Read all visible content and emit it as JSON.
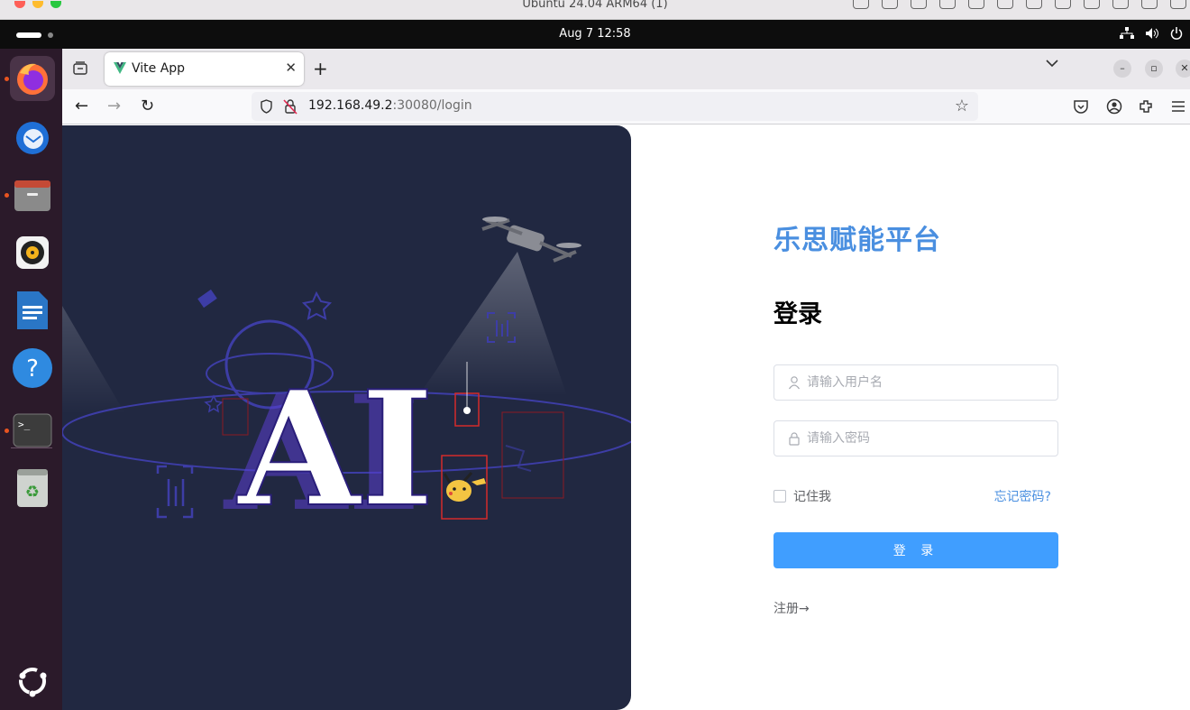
{
  "host": {
    "title": "Ubuntu 24.04 ARM64 (1)"
  },
  "ubuntu": {
    "clock": "Aug 7  12:58"
  },
  "browser": {
    "tab": {
      "title": "Vite App"
    },
    "url": {
      "host": "192.168.49.2",
      "rest": ":30080/login"
    }
  },
  "hero": {
    "text": "AI"
  },
  "login": {
    "brand": "乐思赋能平台",
    "heading": "登录",
    "username_placeholder": "请输入用户名",
    "password_placeholder": "请输入密码",
    "remember_label": "记住我",
    "forgot_label": "忘记密码?",
    "submit_label": "登 录",
    "register_label": "注册→",
    "accent_color": "#409eff"
  }
}
